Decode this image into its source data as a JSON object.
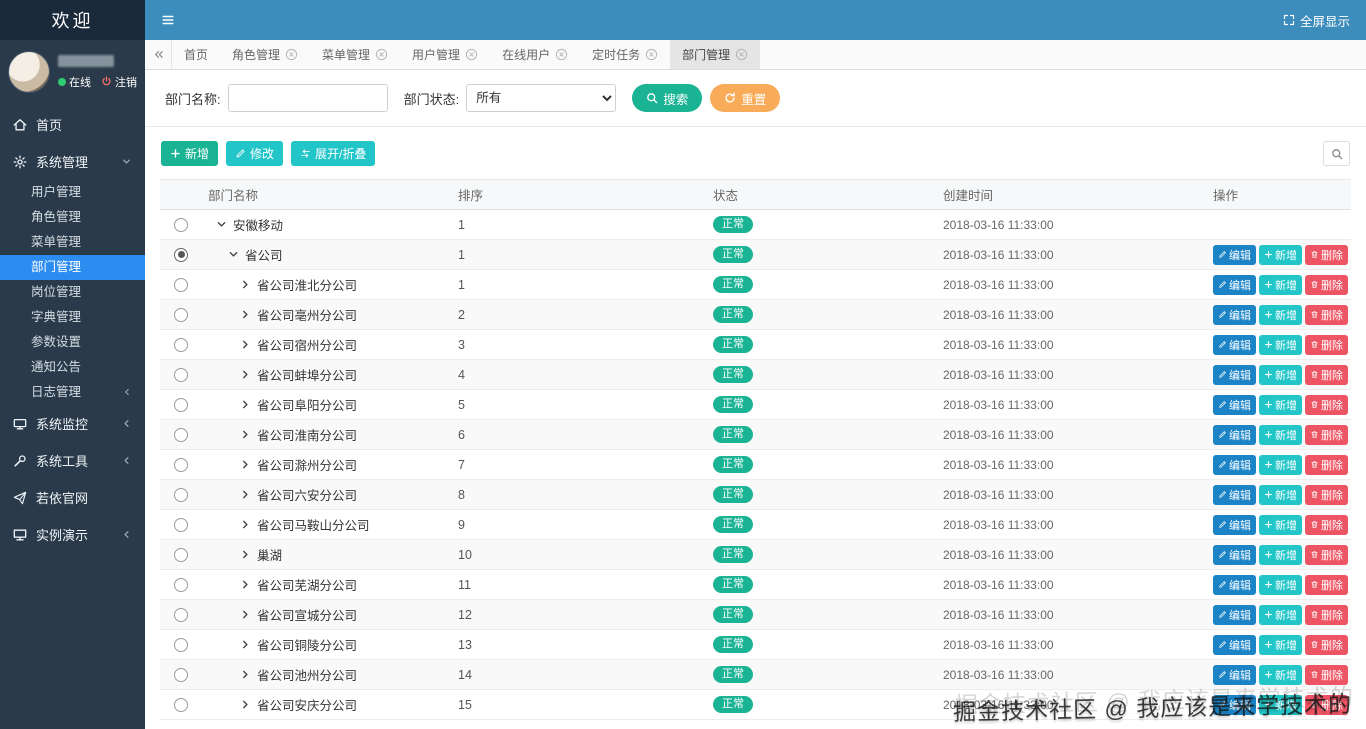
{
  "header": {
    "logo": "欢迎",
    "fullscreen_label": "全屏显示"
  },
  "user": {
    "online_label": "在线",
    "logout_label": "注销"
  },
  "sidebar": {
    "items": [
      {
        "label": "首页",
        "icon": "home-icon"
      },
      {
        "label": "系统管理",
        "icon": "gear-icon",
        "state": "expanded",
        "children": [
          {
            "label": "用户管理"
          },
          {
            "label": "角色管理"
          },
          {
            "label": "菜单管理"
          },
          {
            "label": "部门管理",
            "active": true
          },
          {
            "label": "岗位管理"
          },
          {
            "label": "字典管理"
          },
          {
            "label": "参数设置"
          },
          {
            "label": "通知公告"
          },
          {
            "label": "日志管理",
            "has_children": true
          }
        ]
      },
      {
        "label": "系统监控",
        "icon": "monitor-icon",
        "has_children": true
      },
      {
        "label": "系统工具",
        "icon": "wrench-icon",
        "has_children": true
      },
      {
        "label": "若依官网",
        "icon": "send-icon"
      },
      {
        "label": "实例演示",
        "icon": "desktop-icon",
        "has_children": true
      }
    ]
  },
  "tabs": [
    {
      "label": "首页",
      "closable": false
    },
    {
      "label": "角色管理",
      "closable": true
    },
    {
      "label": "菜单管理",
      "closable": true
    },
    {
      "label": "用户管理",
      "closable": true
    },
    {
      "label": "在线用户",
      "closable": true
    },
    {
      "label": "定时任务",
      "closable": true
    },
    {
      "label": "部门管理",
      "closable": true,
      "active": true
    }
  ],
  "filter": {
    "name_label": "部门名称:",
    "name_value": "",
    "status_label": "部门状态:",
    "status_value": "所有",
    "search_label": "搜索",
    "reset_label": "重置"
  },
  "toolbar": {
    "add_label": "新增",
    "edit_label": "修改",
    "toggle_label": "展开/折叠"
  },
  "table": {
    "columns": [
      "部门名称",
      "排序",
      "状态",
      "创建时间",
      "操作"
    ],
    "actions": {
      "edit": "编辑",
      "add": "新增",
      "delete": "删除"
    },
    "rows": [
      {
        "name": "安徽移动",
        "order": "1",
        "status": "正常",
        "time": "2018-03-16 11:33:00",
        "caret": "down",
        "indent": 0,
        "selected": false,
        "actions": false
      },
      {
        "name": "省公司",
        "order": "1",
        "status": "正常",
        "time": "2018-03-16 11:33:00",
        "caret": "down",
        "indent": 1,
        "selected": true,
        "actions": true
      },
      {
        "name": "省公司淮北分公司",
        "order": "1",
        "status": "正常",
        "time": "2018-03-16 11:33:00",
        "caret": "right",
        "indent": 2,
        "selected": false,
        "actions": true
      },
      {
        "name": "省公司亳州分公司",
        "order": "2",
        "status": "正常",
        "time": "2018-03-16 11:33:00",
        "caret": "right",
        "indent": 2,
        "selected": false,
        "actions": true
      },
      {
        "name": "省公司宿州分公司",
        "order": "3",
        "status": "正常",
        "time": "2018-03-16 11:33:00",
        "caret": "right",
        "indent": 2,
        "selected": false,
        "actions": true
      },
      {
        "name": "省公司蚌埠分公司",
        "order": "4",
        "status": "正常",
        "time": "2018-03-16 11:33:00",
        "caret": "right",
        "indent": 2,
        "selected": false,
        "actions": true
      },
      {
        "name": "省公司阜阳分公司",
        "order": "5",
        "status": "正常",
        "time": "2018-03-16 11:33:00",
        "caret": "right",
        "indent": 2,
        "selected": false,
        "actions": true
      },
      {
        "name": "省公司淮南分公司",
        "order": "6",
        "status": "正常",
        "time": "2018-03-16 11:33:00",
        "caret": "right",
        "indent": 2,
        "selected": false,
        "actions": true
      },
      {
        "name": "省公司滁州分公司",
        "order": "7",
        "status": "正常",
        "time": "2018-03-16 11:33:00",
        "caret": "right",
        "indent": 2,
        "selected": false,
        "actions": true
      },
      {
        "name": "省公司六安分公司",
        "order": "8",
        "status": "正常",
        "time": "2018-03-16 11:33:00",
        "caret": "right",
        "indent": 2,
        "selected": false,
        "actions": true
      },
      {
        "name": "省公司马鞍山分公司",
        "order": "9",
        "status": "正常",
        "time": "2018-03-16 11:33:00",
        "caret": "right",
        "indent": 2,
        "selected": false,
        "actions": true
      },
      {
        "name": "巢湖",
        "order": "10",
        "status": "正常",
        "time": "2018-03-16 11:33:00",
        "caret": "right",
        "indent": 2,
        "selected": false,
        "actions": true
      },
      {
        "name": "省公司芜湖分公司",
        "order": "11",
        "status": "正常",
        "time": "2018-03-16 11:33:00",
        "caret": "right",
        "indent": 2,
        "selected": false,
        "actions": true
      },
      {
        "name": "省公司宣城分公司",
        "order": "12",
        "status": "正常",
        "time": "2018-03-16 11:33:00",
        "caret": "right",
        "indent": 2,
        "selected": false,
        "actions": true
      },
      {
        "name": "省公司铜陵分公司",
        "order": "13",
        "status": "正常",
        "time": "2018-03-16 11:33:00",
        "caret": "right",
        "indent": 2,
        "selected": false,
        "actions": true
      },
      {
        "name": "省公司池州分公司",
        "order": "14",
        "status": "正常",
        "time": "2018-03-16 11:33:00",
        "caret": "right",
        "indent": 2,
        "selected": false,
        "actions": true
      },
      {
        "name": "省公司安庆分公司",
        "order": "15",
        "status": "正常",
        "time": "2018-03-16 11:33:00",
        "caret": "right",
        "indent": 2,
        "selected": false,
        "actions": true
      }
    ]
  },
  "watermark": "掘金技术社区 @ 我应该是来学技术的",
  "colors": {
    "navbar": "#3c8dbc",
    "sidebar": "#2b3a4a",
    "active_menu": "#2d8cf0",
    "success": "#1ab394",
    "warning": "#f8ac59",
    "info": "#23c6c8",
    "primary": "#1c84c6",
    "danger": "#ed5565"
  }
}
